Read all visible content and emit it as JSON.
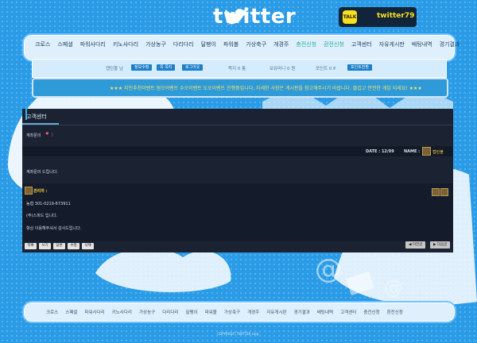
{
  "header": {
    "logo_text": "twitter",
    "kakao_badge": "TALK",
    "kakao_id": "twitter79"
  },
  "nav": {
    "items": [
      "크로스",
      "스페셜",
      "파워사다리",
      "키노사다리",
      "가상농구",
      "다리다리",
      "달팽이",
      "파워볼",
      "가상축구",
      "개경주",
      "충전신청",
      "환전신청",
      "고객센터",
      "자유게시판",
      "배팅내역",
      "경기결과"
    ]
  },
  "login_bar": {
    "greeting": "캡틴볼 님",
    "buttons": [
      "정보수정",
      "쪽 쪽지",
      "로그아웃",
      "포인트전환"
    ],
    "messages_label": "쪽지 0 통",
    "money_label": "보유머니 0 원",
    "points_label": "포인트 0 P"
  },
  "marquee": {
    "text": "★★★ 지인추천이벤트 원오어벤트 수오이벤트 도오이벤트 진행중입니다. 자세한 사항은 게시판을 참고해주시기 바랍니다. 즐겁고 안전한 게임 되세요! ★★★"
  },
  "panel": {
    "title": "고객센터",
    "status_text": "계좌문의",
    "status_icon": "heart-icon",
    "date_label": "DATE : 12/09",
    "name_label": "NAME :",
    "author": "캡틴볼",
    "body": "계좌문의 드립니다.",
    "reply_author": "관리자 :",
    "reply_lines": [
      "농협 301-0219-673911",
      "(주)스피드 입니다.",
      "항상 이용해주셔서 감사드립니다."
    ],
    "actions": [
      "목록",
      "쓰기",
      "답변",
      "수정",
      "삭제"
    ],
    "prev_label": "◀ 이전글",
    "next_label": "▶ 다음글"
  },
  "footer": {
    "items": [
      "크로스",
      "스페셜",
      "파워사다리",
      "키노사다리",
      "가상농구",
      "다리다리",
      "달팽이",
      "파워볼",
      "가상축구",
      "개경주",
      "자유게시판",
      "경기결과",
      "배팅내역",
      "고객센터",
      "충전신청",
      "환전신청"
    ],
    "copyright": "COPYRIGHT TWITTER corp."
  },
  "colors": {
    "background": "#2a9be6",
    "accent": "#20b2a0",
    "kakao_yellow": "#f7e01c"
  }
}
